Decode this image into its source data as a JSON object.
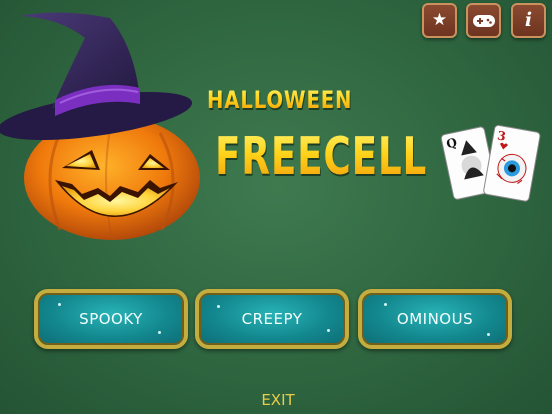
{
  "top_buttons": {
    "favorite_icon": "star-icon",
    "games_icon": "gamepad-icon",
    "info_icon": "info-icon",
    "info_glyph": "i"
  },
  "title": {
    "line1": "HALLOWEEN",
    "line2": "FREECELL"
  },
  "cards": {
    "front_rank": "3",
    "back_rank": "Q"
  },
  "modes": [
    {
      "label": "SPOOKY"
    },
    {
      "label": "CREEPY"
    },
    {
      "label": "OMINOUS"
    }
  ],
  "exit_label": "EXIT",
  "colors": {
    "background": "#2f6640",
    "title_yellow": "#ffd21a",
    "button_teal": "#13888f",
    "button_border": "#c4ad3e",
    "exit_text": "#e8cc4a",
    "top_button": "#7a3e28"
  }
}
